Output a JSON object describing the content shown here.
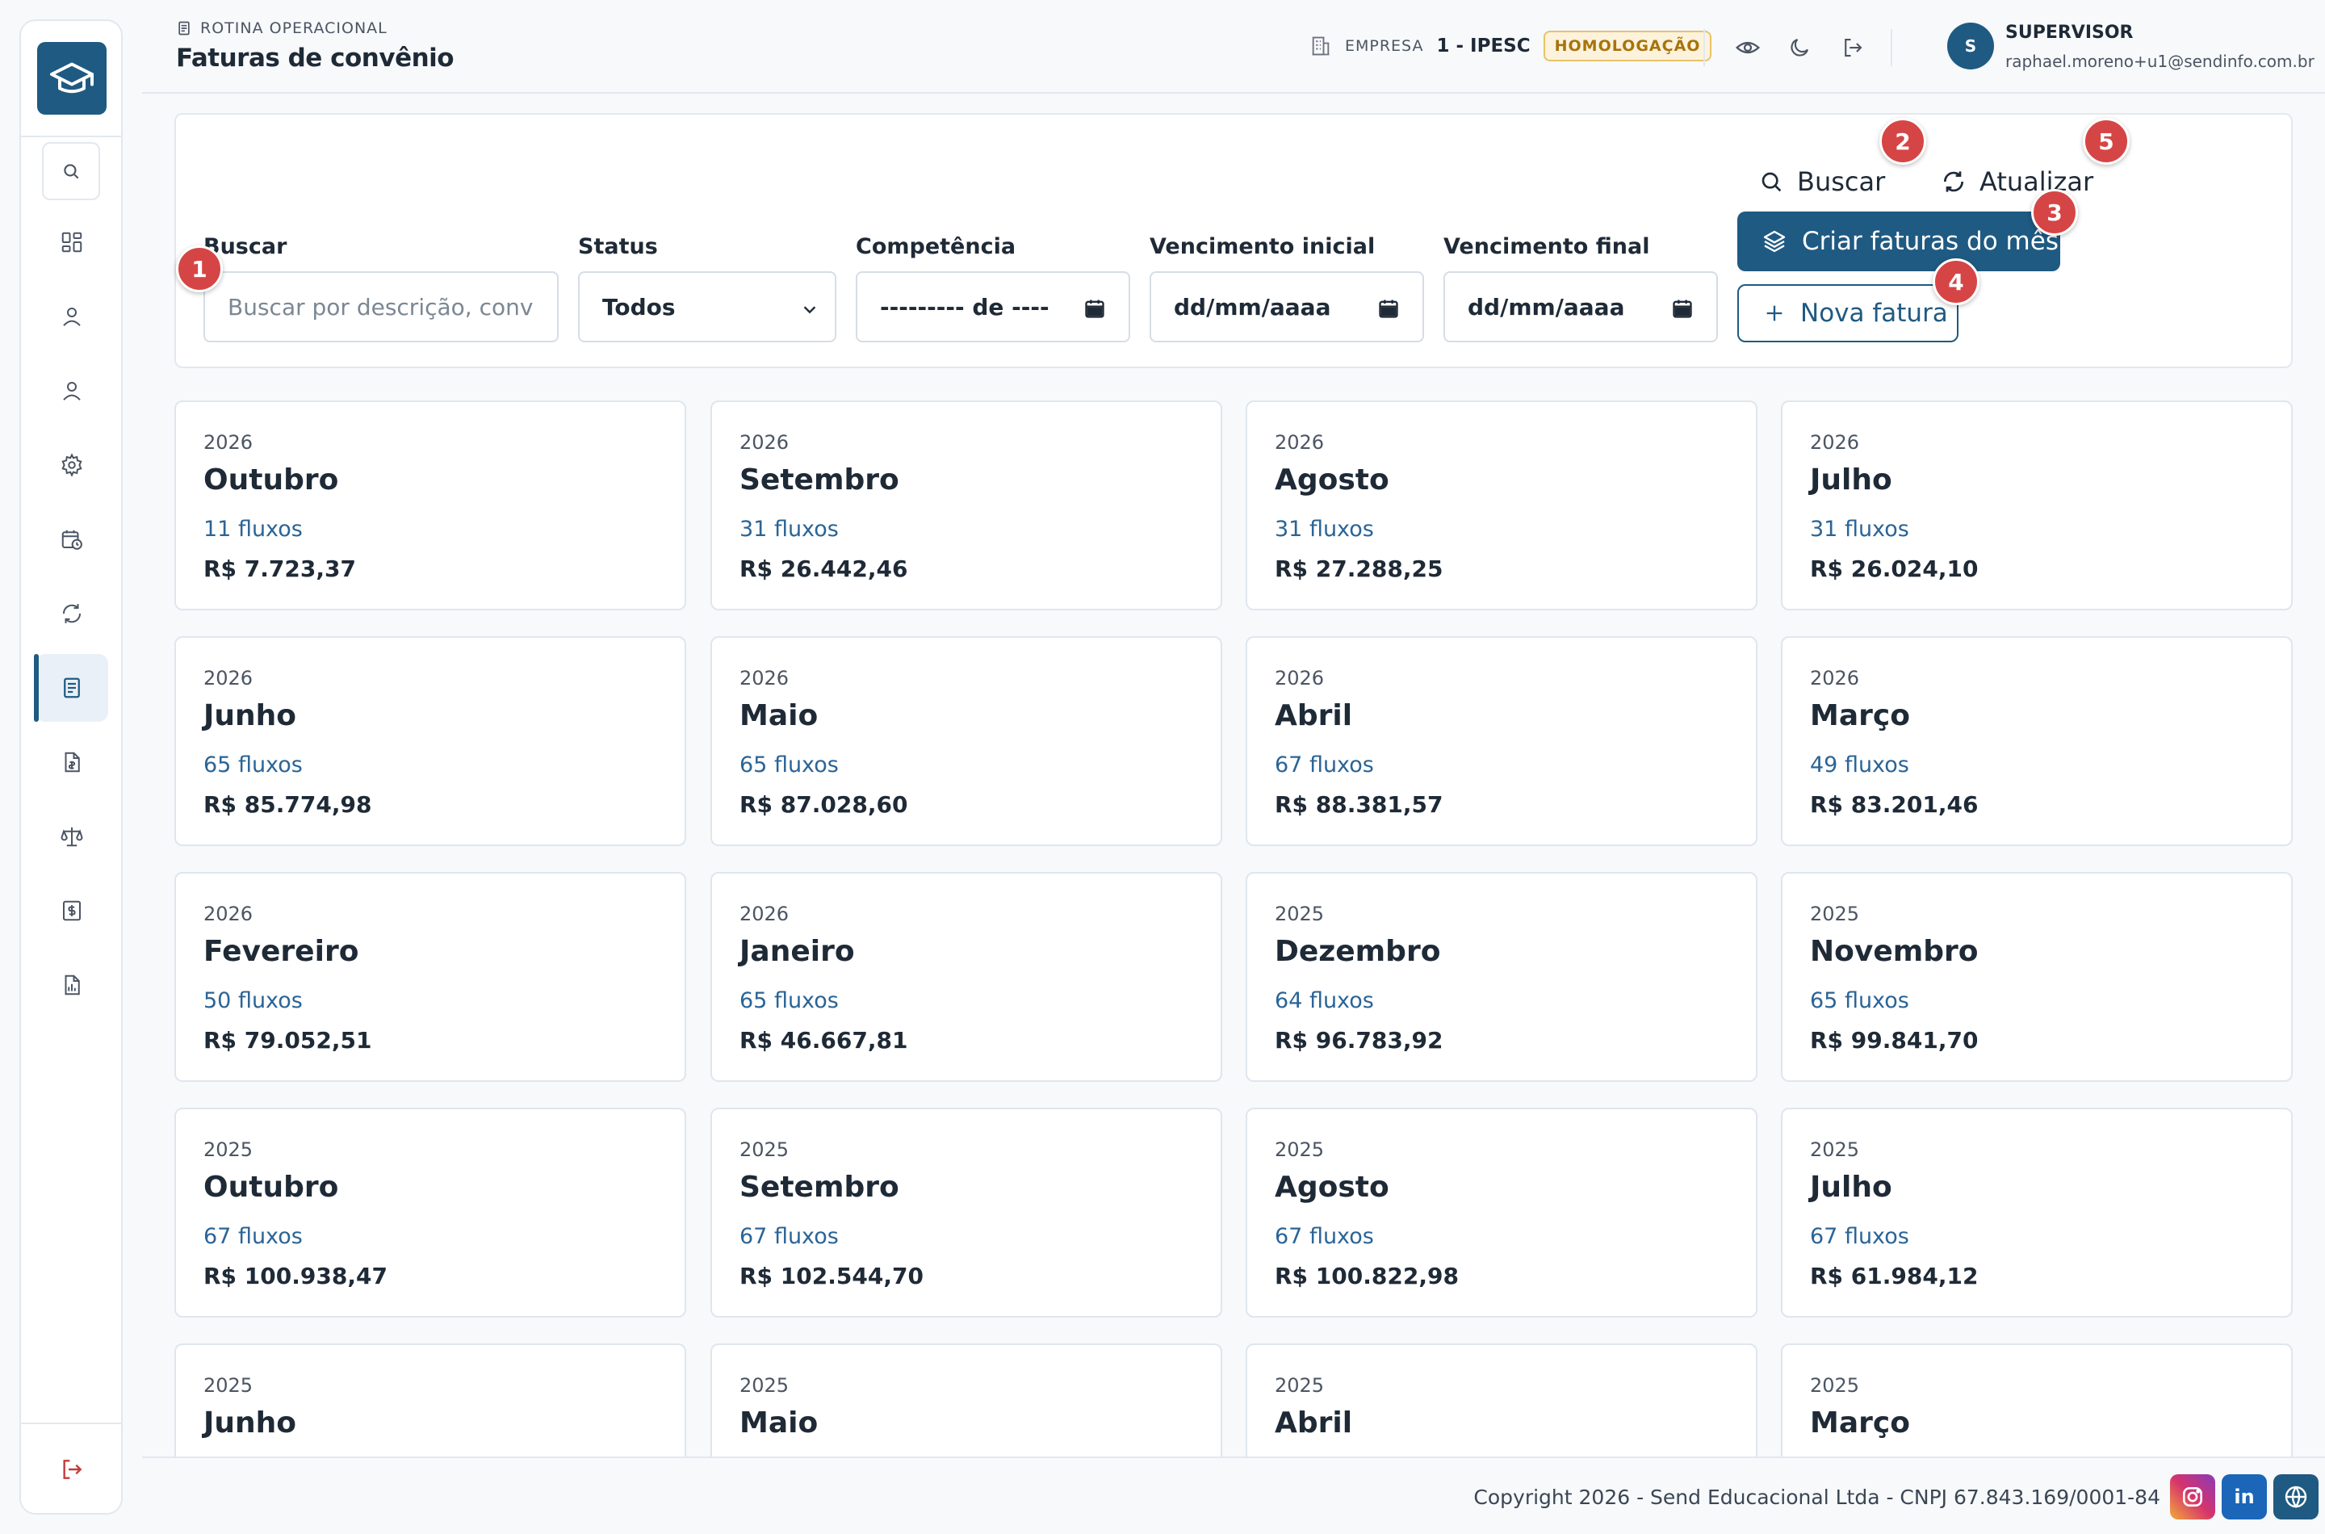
{
  "header": {
    "breadcrumb": "ROTINA OPERACIONAL",
    "title": "Faturas de convênio",
    "company_label": "EMPRESA",
    "company_value": "1 - IPESC",
    "environment_badge": "HOMOLOGAÇÃO",
    "user_initial": "S",
    "user_role": "SUPERVISOR",
    "user_email": "raphael.moreno+u1@sendinfo.com.br"
  },
  "sidebar": {
    "items": [
      {
        "name": "search-icon"
      },
      {
        "name": "dashboard-icon"
      },
      {
        "name": "user-icon"
      },
      {
        "name": "user-icon"
      },
      {
        "name": "gear-icon"
      },
      {
        "name": "calendar-clock-icon"
      },
      {
        "name": "refresh-icon"
      },
      {
        "name": "document-list-icon",
        "active": true
      },
      {
        "name": "file-money-icon"
      },
      {
        "name": "scale-icon"
      },
      {
        "name": "dollar-document-icon"
      },
      {
        "name": "report-icon"
      }
    ],
    "logout": "logout-icon"
  },
  "filters": {
    "search_label": "Buscar",
    "search_placeholder": "Buscar por descrição, conv",
    "status_label": "Status",
    "status_value": "Todos",
    "competencia_label": "Competência",
    "competencia_value": "--------- de ----",
    "venc_ini_label": "Vencimento inicial",
    "venc_ini_value": "dd/mm/aaaa",
    "venc_fim_label": "Vencimento final",
    "venc_fim_value": "dd/mm/aaaa",
    "buscar_button": "Buscar",
    "atualizar_button": "Atualizar",
    "criar_button": "Criar faturas do mês",
    "nova_button": "Nova fatura"
  },
  "markers": [
    "1",
    "2",
    "3",
    "4",
    "5"
  ],
  "cards": [
    {
      "year": "2026",
      "month": "Outubro",
      "flows": "11 fluxos",
      "amount": "R$ 7.723,37"
    },
    {
      "year": "2026",
      "month": "Setembro",
      "flows": "31 fluxos",
      "amount": "R$ 26.442,46"
    },
    {
      "year": "2026",
      "month": "Agosto",
      "flows": "31 fluxos",
      "amount": "R$ 27.288,25"
    },
    {
      "year": "2026",
      "month": "Julho",
      "flows": "31 fluxos",
      "amount": "R$ 26.024,10"
    },
    {
      "year": "2026",
      "month": "Junho",
      "flows": "65 fluxos",
      "amount": "R$ 85.774,98"
    },
    {
      "year": "2026",
      "month": "Maio",
      "flows": "65 fluxos",
      "amount": "R$ 87.028,60"
    },
    {
      "year": "2026",
      "month": "Abril",
      "flows": "67 fluxos",
      "amount": "R$ 88.381,57"
    },
    {
      "year": "2026",
      "month": "Março",
      "flows": "49 fluxos",
      "amount": "R$ 83.201,46"
    },
    {
      "year": "2026",
      "month": "Fevereiro",
      "flows": "50 fluxos",
      "amount": "R$ 79.052,51"
    },
    {
      "year": "2026",
      "month": "Janeiro",
      "flows": "65 fluxos",
      "amount": "R$ 46.667,81"
    },
    {
      "year": "2025",
      "month": "Dezembro",
      "flows": "64 fluxos",
      "amount": "R$ 96.783,92"
    },
    {
      "year": "2025",
      "month": "Novembro",
      "flows": "65 fluxos",
      "amount": "R$ 99.841,70"
    },
    {
      "year": "2025",
      "month": "Outubro",
      "flows": "67 fluxos",
      "amount": "R$ 100.938,47"
    },
    {
      "year": "2025",
      "month": "Setembro",
      "flows": "67 fluxos",
      "amount": "R$ 102.544,70"
    },
    {
      "year": "2025",
      "month": "Agosto",
      "flows": "67 fluxos",
      "amount": "R$ 100.822,98"
    },
    {
      "year": "2025",
      "month": "Julho",
      "flows": "67 fluxos",
      "amount": "R$ 61.984,12"
    },
    {
      "year": "2025",
      "month": "Junho",
      "flows": "",
      "amount": ""
    },
    {
      "year": "2025",
      "month": "Maio",
      "flows": "",
      "amount": ""
    },
    {
      "year": "2025",
      "month": "Abril",
      "flows": "",
      "amount": ""
    },
    {
      "year": "2025",
      "month": "Março",
      "flows": "",
      "amount": ""
    }
  ],
  "footer": {
    "copyright": "Copyright 2026 - Send Educacional Ltda - CNPJ 67.843.169/0001-84",
    "linkedin_label": "in"
  },
  "colors": {
    "primary": "#1f5a82",
    "marker": "#d64545",
    "badge_bg": "#fdf3dd",
    "flows_text": "#2a6496"
  }
}
